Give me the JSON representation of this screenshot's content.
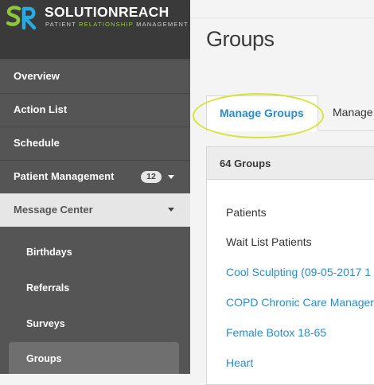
{
  "brand": {
    "name": "SOLUTIONREACH",
    "tagline_left": "PATIENT ",
    "tagline_mid": "RELATIONSHIP",
    "tagline_right": " MANAGEMENT",
    "logo_text": "SR",
    "colors": {
      "green": "#8dc63f",
      "blue": "#27a9e1"
    }
  },
  "sidebar": {
    "items": [
      {
        "label": "Overview"
      },
      {
        "label": "Action List"
      },
      {
        "label": "Schedule"
      },
      {
        "label": "Patient Management",
        "badge": "12"
      },
      {
        "label": "Message Center"
      }
    ],
    "subitems": [
      {
        "label": "Birthdays"
      },
      {
        "label": "Referrals"
      },
      {
        "label": "Surveys"
      },
      {
        "label": "Groups"
      }
    ]
  },
  "main": {
    "title": "Groups",
    "tabs": [
      {
        "label": "Manage Groups"
      },
      {
        "label": "Manage"
      }
    ],
    "panel": {
      "header": "64 Groups",
      "rows": [
        {
          "label": "Patients"
        },
        {
          "label": "Wait List Patients"
        },
        {
          "label": "Cool Sculpting (09-05-2017 1"
        },
        {
          "label": "COPD Chronic Care Manager"
        },
        {
          "label": "Female Botox 18-65"
        },
        {
          "label": "Heart"
        }
      ]
    }
  },
  "colors": {
    "link": "#2e8bcb",
    "sidebar": "#555555",
    "highlight": "#d8e33a"
  }
}
